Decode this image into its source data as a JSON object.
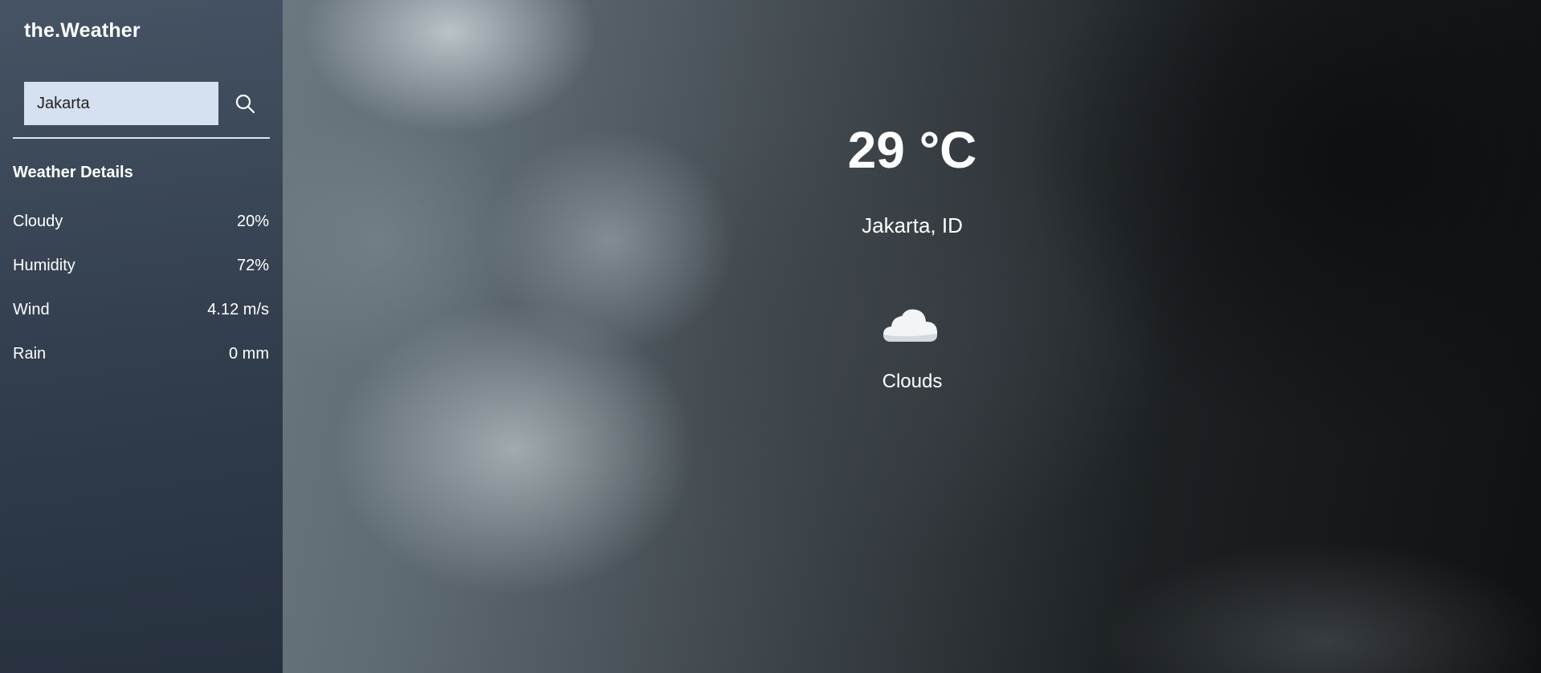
{
  "app": {
    "brand": "the.Weather"
  },
  "search": {
    "value": "Jakarta",
    "placeholder": "",
    "button_icon": "search-icon"
  },
  "sidebar": {
    "heading": "Weather Details",
    "details": [
      {
        "label": "Cloudy",
        "value": "20%"
      },
      {
        "label": "Humidity",
        "value": "72%"
      },
      {
        "label": "Wind",
        "value": "4.12 m/s"
      },
      {
        "label": "Rain",
        "value": "0 mm"
      }
    ]
  },
  "current": {
    "temperature": "29 °C",
    "location": "Jakarta, ID",
    "condition": "Clouds",
    "icon": "cloud-icon"
  },
  "colors": {
    "search_field_bg": "#d5e0f0",
    "sidebar_bg": "#2e3b4c",
    "text": "#ffffff"
  }
}
